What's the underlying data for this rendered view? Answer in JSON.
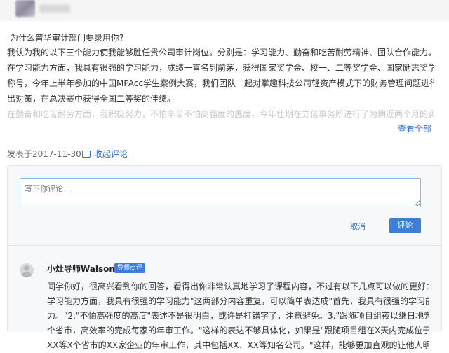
{
  "header": {},
  "post": {
    "question": "为什么普华审计部门要录用你?",
    "answer_lines": [
      "我认为我的以下三个能力使我能够胜任贵公司审计岗位。分别是：学习能力、勤奋和吃苦耐劳精神、团队合作能力。",
      "在学习能力方面，我具有很强的学习能力，成绩一直名列前茅，获得国家奖学金、校一、二等奖学金、国家励志奖学金等荣誉",
      "称号，今年上半年参加的中国MPAcc学生案例大赛，我们团队一起对掌趣科技公司轻资产模式下的财务管理问题进行分析并提",
      "出对策，在总决赛中获得全国二等奖的佳绩。"
    ],
    "answer_faded": "在勤奋和吃苦耐劳方面，我积极努力，不怕辛苦不怕高强度的惠度，今年仕期在立信事务所进行了为期近两个月的实习，跟随",
    "view_all": "查看全部",
    "posted_at": "发表于2017-11-30",
    "collapse_comments": "收起评论"
  },
  "comment_box": {
    "placeholder": "写下你评论...",
    "cancel_label": "取消",
    "submit_label": "评论"
  },
  "review": {
    "author": "小灶导师Walson",
    "badge": "导师点评",
    "lines": [
      "同学你好，很高兴看到你的回答，看得出你非常认真地学习了课程内容，不过有以下几点可以做的更好：1.\"在",
      "学习能力方面，我具有很强的学习能力\"这两部分内容重复，可以简单表达成\"首先，我具有很强的学习能",
      "力。\"2.\"不怕高强度的高度\"表述不是很明白，或许是打错字了，注意避免。3.\"跟随项目组夜以继日地奔波于各",
      "个省市，高效率的完成每家的年审工作。\"这样的表达不够具体化，如果是\"跟随项目组在X天内完成位于XX、",
      "XX等X个省市的XX家企业的年审工作，其中包括XX、XX等知名公司。\"这样，能够更加直观的让他人明确你"
    ]
  }
}
